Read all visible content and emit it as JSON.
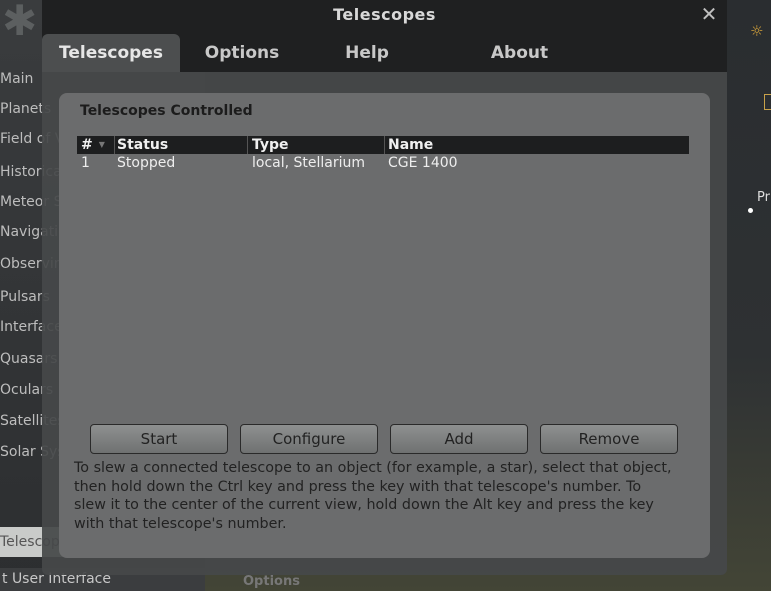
{
  "background": {
    "sidebar_items": [
      {
        "label": "Main"
      },
      {
        "label": "Planets"
      },
      {
        "label": "Field of View"
      },
      {
        "label": "Historical"
      },
      {
        "label": "Meteor Showers"
      },
      {
        "label": "Navigation"
      },
      {
        "label": "Observing"
      },
      {
        "label": "Pulsars"
      },
      {
        "label": "Interface"
      },
      {
        "label": "Quasars"
      },
      {
        "label": "Oculars"
      },
      {
        "label": "Satellites"
      },
      {
        "label": "Solar System"
      },
      {
        "label": "Telescope Control",
        "selected": true
      }
    ],
    "bottom_item": "t User Interface",
    "options_label": "Options",
    "side_label": "Pr"
  },
  "dialog": {
    "title": "Telescopes",
    "close_glyph": "✕",
    "tabs": [
      {
        "label": "Telescopes",
        "active": true
      },
      {
        "label": "Options"
      },
      {
        "label": "Help"
      },
      {
        "label": "About"
      }
    ],
    "group_title": "Telescopes Controlled",
    "table": {
      "headers": [
        "#",
        "Status",
        "Type",
        "Name"
      ],
      "rows": [
        {
          "num": "1",
          "status": "Stopped",
          "type": "local, Stellarium",
          "name": "CGE 1400"
        }
      ]
    },
    "buttons": {
      "start": "Start",
      "configure": "Configure",
      "add": "Add",
      "remove": "Remove"
    },
    "help_text": "To slew a connected telescope to an object (for example, a star), select that object, then hold down the Ctrl key and press the key with that telescope's number. To slew it to the center of the current view, hold down the Alt key and press the key with that telescope's number."
  },
  "colors": {
    "titlebar": "#1f2021",
    "panel": "#6b6c6d",
    "table_header": "#1d1e1f"
  }
}
